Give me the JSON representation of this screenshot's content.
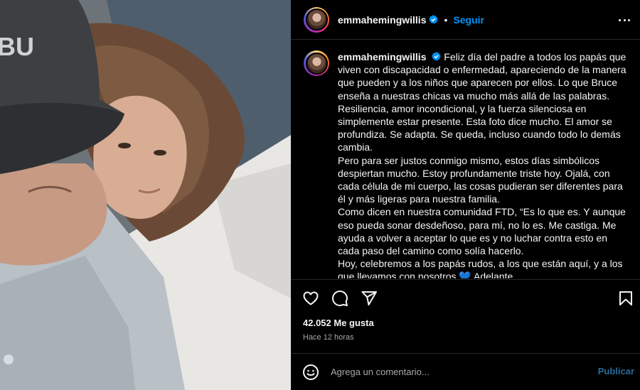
{
  "post": {
    "username": "emmahemingwillis",
    "dot": "•",
    "follow_label": "Seguir",
    "caption_paragraphs": [
      "Feliz día del padre a todos los papás que viven con discapacidad o enfermedad, apareciendo de la manera que pueden y a los niños que aparecen por ellos. Lo que Bruce enseña a nuestras chicas va mucho más allá de las palabras. Resiliencia, amor incondicional, y la fuerza silenciosa en simplemente estar presente. Esta foto dice mucho. El amor se profundiza. Se adapta. Se queda, incluso cuando todo lo demás cambia.",
      "Pero para ser justos conmigo mismo, estos días simbólicos despiertan mucho. Estoy profundamente triste hoy. Ojalá, con cada célula de mi cuerpo, las cosas pudieran ser diferentes para él y más ligeras para nuestra familia.",
      "Como dicen en nuestra comunidad FTD, “Es lo que es. Y aunque eso pueda sonar desdeñoso, para mí, no lo es. Me castiga. Me ayuda a volver a aceptar lo que es y no luchar contra esto en cada paso del camino como solía hacerlo.",
      "Hoy, celebremos a los papás rudos, a los que están aquí, y a los que llevamos con nosotros 💙 Adelante."
    ],
    "likes": "42.052 Me gusta",
    "time_ago": "Hace 12 horas",
    "comment_placeholder": "Agrega un comentario...",
    "publish_label": "Publicar",
    "cap_text": "BU"
  },
  "icons": {
    "heart": "heart-icon",
    "comment": "comment-icon",
    "share": "share-icon",
    "save": "bookmark-icon",
    "emoji": "emoji-icon",
    "more": "more-options-icon",
    "verified": "verified-badge-icon"
  },
  "colors": {
    "background": "#000000",
    "text": "#f5f5f5",
    "secondary_text": "#a8a8a8",
    "accent": "#0095f6",
    "verified": "#0095f6",
    "publish_disabled": "#2a6a9a",
    "divider": "#262626"
  }
}
